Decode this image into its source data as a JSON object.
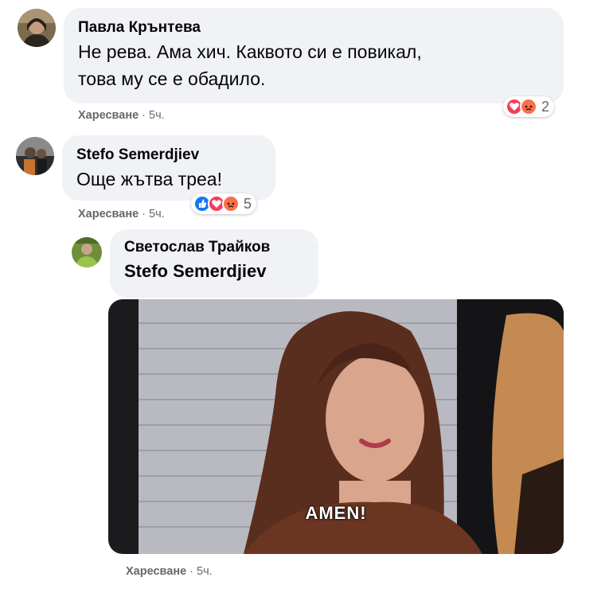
{
  "comments": [
    {
      "author": "Павла Крънтева",
      "lines": [
        "Не рева. Ама хич. Каквото си е повикал,",
        "това му се е обадило."
      ],
      "like_label": "Харесване",
      "time": "5ч.",
      "reactions": [
        "love",
        "angry"
      ],
      "reaction_count": "2"
    },
    {
      "author": "Stefo Semerdjiev",
      "lines": [
        "Още жътва треа!"
      ],
      "like_label": "Харесване",
      "time": "5ч.",
      "reactions": [
        "like",
        "love",
        "angry"
      ],
      "reaction_count": "5"
    }
  ],
  "reply": {
    "author": "Светослав Трайков",
    "mention": "Stefo Semerdjiev",
    "gif_caption": "AMEN!",
    "like_label": "Харесване",
    "time": "5ч."
  },
  "separator": "·",
  "colors": {
    "bubble": "#f0f2f5",
    "meta": "#65676b",
    "like": "#1877f2",
    "love": "#f33e58",
    "angry": "#f7714b"
  }
}
